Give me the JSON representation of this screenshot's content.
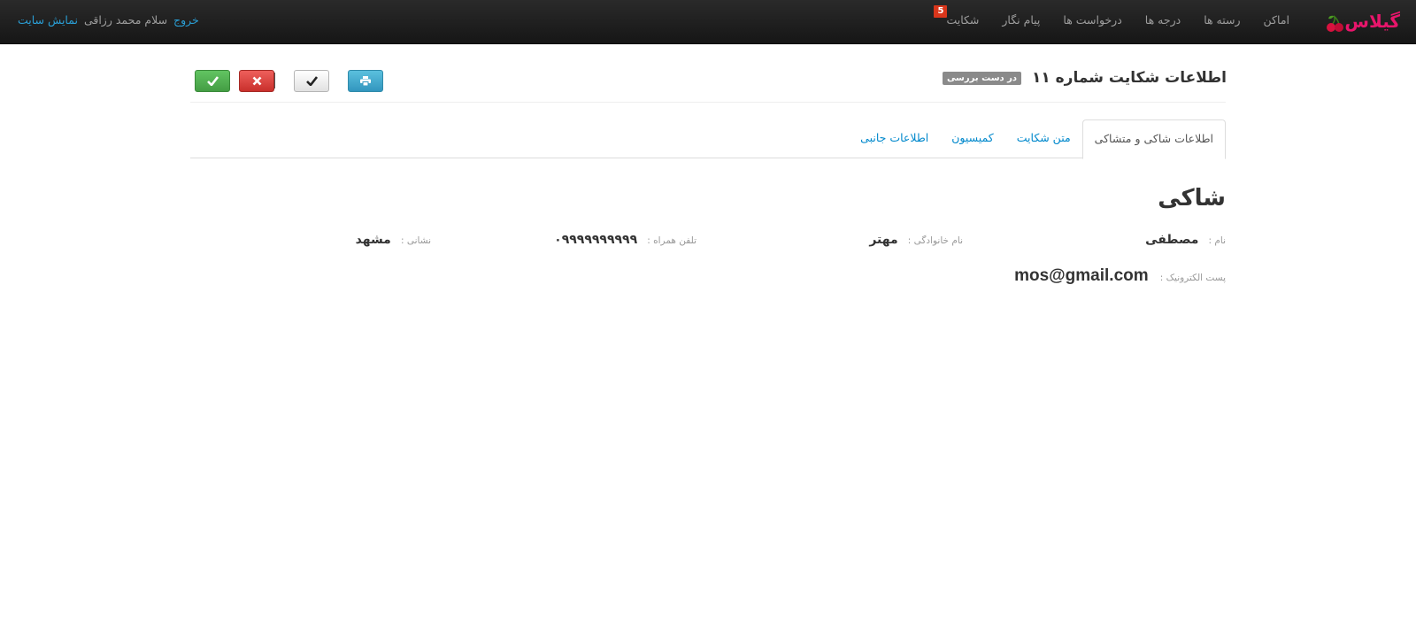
{
  "navbar": {
    "brand": "گیلاس",
    "items": [
      {
        "label": "اماکن"
      },
      {
        "label": "رسته ها"
      },
      {
        "label": "درجه ها"
      },
      {
        "label": "درخواست ها"
      },
      {
        "label": "پیام نگار"
      },
      {
        "label": "شکایت",
        "badge": "5"
      }
    ],
    "view_site": "نمایش سایت",
    "greeting": "سلام محمد رزاقی",
    "logout": "خروج"
  },
  "header": {
    "title": "اطلاعات شکایت شماره ۱۱",
    "status": "در دست بررسی",
    "buttons": {
      "print_icon": "print-icon",
      "check_icon": "check-icon",
      "reject_icon": "times-icon",
      "accept_icon": "check-icon"
    },
    "separator": "|"
  },
  "tabs": [
    {
      "label": "اطلاعات شاکی و متشاکی",
      "active": true
    },
    {
      "label": "متن شکایت",
      "active": false
    },
    {
      "label": "کمیسیون",
      "active": false
    },
    {
      "label": "اطلاعات جانبی",
      "active": false
    }
  ],
  "complainant": {
    "heading": "شاکی",
    "name_label": "نام :",
    "name": "مصطفی",
    "family_label": "نام خانوادگی :",
    "family": "مهتر",
    "mobile_label": "تلفن همراه :",
    "mobile": "۰۹۹۹۹۹۹۹۹۹۹",
    "address_label": "نشانی :",
    "address": "مشهد",
    "email_label": "پست الکترونیک :",
    "email": "mos@gmail.com"
  },
  "colors": {
    "navbar": "#1b1b1b",
    "brand": "#e8156b",
    "link": "#2a9fd6",
    "badge": "#d9361b"
  }
}
